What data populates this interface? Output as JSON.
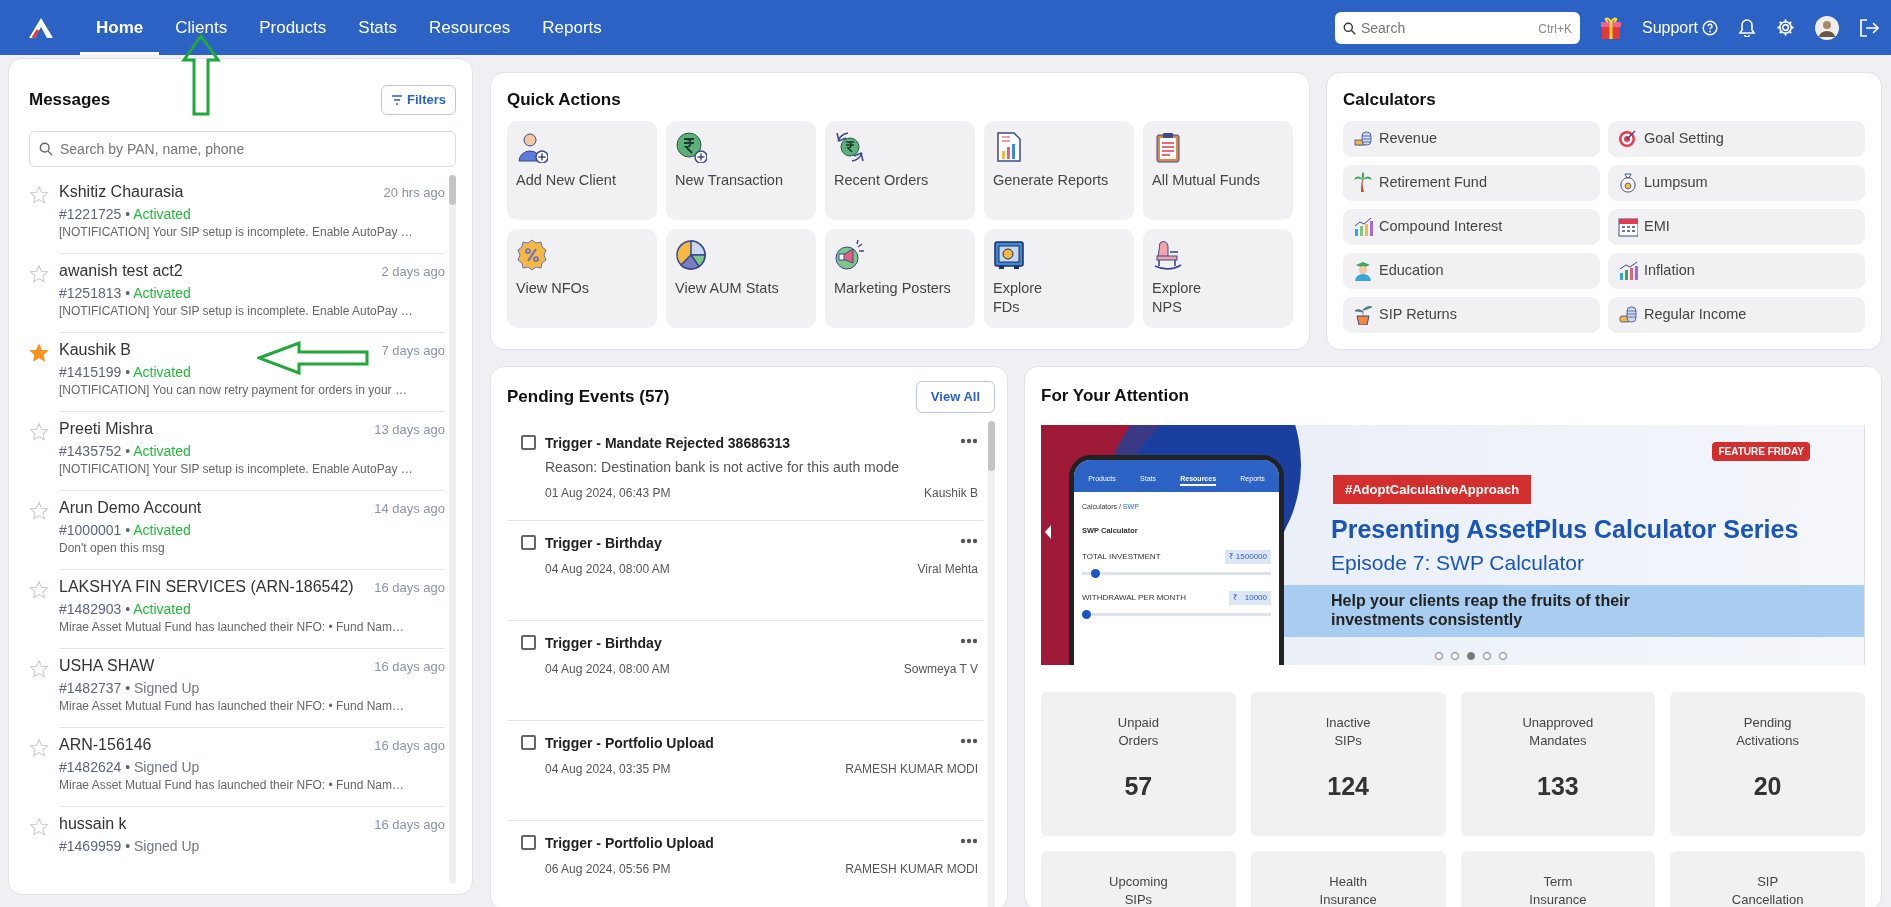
{
  "nav": {
    "tabs": [
      {
        "label": "Home",
        "selected": true
      },
      {
        "label": "Clients",
        "selected": false,
        "pointer_arrow": true
      },
      {
        "label": "Products",
        "selected": false
      },
      {
        "label": "Stats",
        "selected": false
      },
      {
        "label": "Resources",
        "selected": false
      },
      {
        "label": "Reports",
        "selected": false
      }
    ],
    "search": {
      "placeholder": "Search",
      "shortcut": "Ctrl+K"
    },
    "support": "Support"
  },
  "messages": {
    "title": "Messages",
    "filter_button": "Filters",
    "search": {
      "placeholder": "Search by PAN, name, phone"
    },
    "items": [
      {
        "name": "Kshitiz Chaurasia",
        "time": "20 hrs ago",
        "client_id": "#1221725",
        "separator": "•",
        "status": "Activated",
        "color": "#22b93b",
        "preview": "[NOTIFICATION] Your SIP setup is incomplete. Enable AutoPay …",
        "starred": false
      },
      {
        "name": "awanish test act2",
        "time": "2 days ago",
        "client_id": "#1251813",
        "separator": "•",
        "status": "Activated",
        "color": "#22b93b",
        "preview": "[NOTIFICATION] Your SIP setup is incomplete. Enable AutoPay …",
        "starred": false
      },
      {
        "name": "Kaushik B",
        "time": "7 days ago",
        "client_id": "#1415199",
        "separator": "•",
        "status": "Activated",
        "color": "#22b93b",
        "preview": "[NOTIFICATION] You can now retry payment for orders in your …",
        "starred": true,
        "pointer_arrow": true
      },
      {
        "name": "Preeti Mishra",
        "time": "13 days ago",
        "client_id": "#1435752",
        "separator": "•",
        "status": "Activated",
        "color": "#22b93b",
        "preview": "[NOTIFICATION] Your SIP setup is incomplete. Enable AutoPay …",
        "starred": false
      },
      {
        "name": "Arun Demo Account",
        "time": "14 days ago",
        "client_id": "#1000001",
        "separator": "•",
        "status": "Activated",
        "color": "#22b93b",
        "preview": "Don't open this msg",
        "starred": false
      },
      {
        "name": "LAKSHYA FIN SERVICES (ARN-186542)",
        "time": "16 days ago",
        "client_id": "#1482903",
        "separator": "•",
        "status": "Activated",
        "color": "#22b93b",
        "preview": "Mirae Asset Mutual Fund has launched their NFO: • Fund Nam…",
        "starred": false
      },
      {
        "name": "USHA SHAW",
        "time": "16 days ago",
        "client_id": "#1482737",
        "separator": "•",
        "status": "Signed Up",
        "color": "#707785",
        "preview": "Mirae Asset Mutual Fund has launched their NFO: • Fund Nam…",
        "starred": false
      },
      {
        "name": "ARN-156146",
        "time": "16 days ago",
        "client_id": "#1482624",
        "separator": "•",
        "status": "Signed Up",
        "color": "#707785",
        "preview": "Mirae Asset Mutual Fund has launched their NFO: • Fund Nam…",
        "starred": false
      },
      {
        "name": "hussain k",
        "time": "16 days ago",
        "client_id": "#1469959",
        "separator": "•",
        "status": "Signed Up",
        "color": "#707785",
        "starred": false
      }
    ]
  },
  "quick_actions": {
    "title": "Quick Actions",
    "items": [
      {
        "label": "Add New Client"
      },
      {
        "label": "New Transaction"
      },
      {
        "label": "Recent Orders"
      },
      {
        "label": "Generate Reports"
      },
      {
        "label": "All Mutual Funds"
      },
      {
        "label": "View NFOs"
      },
      {
        "label": "View AUM Stats"
      },
      {
        "label": "Marketing Posters"
      },
      {
        "label": "Explore\nFDs"
      },
      {
        "label": "Explore\nNPS"
      }
    ]
  },
  "calculators": {
    "title": "Calculators",
    "items": [
      "Revenue",
      "Goal Setting",
      "Retirement Fund",
      "Lumpsum",
      "Compound Interest",
      "EMI",
      "Education",
      "Inflation",
      "SIP Returns",
      "Regular Income"
    ]
  },
  "pending_events": {
    "title": "Pending Events (57)",
    "view_all": "View All",
    "items": [
      {
        "title": "Trigger - Mandate Rejected 38686313",
        "reason": "Reason: Destination bank is not active for this auth mode",
        "date": "01 Aug 2024, 06:43 PM",
        "client": "Kaushik B",
        "checked": false
      },
      {
        "title": "Trigger - Birthday",
        "date": "04 Aug 2024, 08:00 AM",
        "client": "Viral Mehta",
        "checked": false
      },
      {
        "title": "Trigger - Birthday",
        "date": "04 Aug 2024, 08:00 AM",
        "client": "Sowmeya T V",
        "checked": false
      },
      {
        "title": "Trigger - Portfolio Upload",
        "date": "04 Aug 2024, 03:35 PM",
        "client": "RAMESH KUMAR MODI",
        "checked": false
      },
      {
        "title": "Trigger - Portfolio Upload",
        "date": "06 Aug 2024, 05:56 PM",
        "client": "RAMESH KUMAR MODI",
        "checked": false
      }
    ]
  },
  "attention": {
    "title": "For Your Attention",
    "banner": {
      "tag": "FEATURE FRIDAY",
      "hashtag": "#AdoptCalculativeApproach",
      "headline": "Presenting AssetPlus Calculator Series",
      "subtitle": "Episode 7: SWP Calculator",
      "tagline": "Help your clients reap the fruits of their\ninvestments consistently",
      "phone": {
        "tabs": [
          {
            "label": "Products",
            "selected": false
          },
          {
            "label": "Stats",
            "selected": false
          },
          {
            "label": "Resources",
            "selected": true
          },
          {
            "label": "Reports",
            "selected": false
          }
        ],
        "breadcrumb": "Calculators",
        "breadcrumb_separator": "/",
        "breadcrumb_current": "SWP",
        "screen_title": "SWP Calculator",
        "fields": [
          {
            "label": "TOTAL INVESTMENT",
            "value": "₹ 1500000",
            "level": 0.05
          },
          {
            "label": "WITHDRAWAL PER MONTH",
            "value": "₹   10000",
            "level": 0
          }
        ]
      }
    },
    "dots": [
      {
        "selected": false
      },
      {
        "selected": false
      },
      {
        "selected": true
      },
      {
        "selected": false
      },
      {
        "selected": false
      }
    ],
    "stats": [
      {
        "label": "Unpaid\nOrders",
        "value": "57"
      },
      {
        "label": "Inactive\nSIPs",
        "value": "124"
      },
      {
        "label": "Unapproved\nMandates",
        "value": "133"
      },
      {
        "label": "Pending\nActivations",
        "value": "20"
      },
      {
        "label": "Upcoming\nSIPs"
      },
      {
        "label": "Health\nInsurance"
      },
      {
        "label": "Term\nInsurance"
      },
      {
        "label": "SIP\nCancellation"
      }
    ]
  }
}
